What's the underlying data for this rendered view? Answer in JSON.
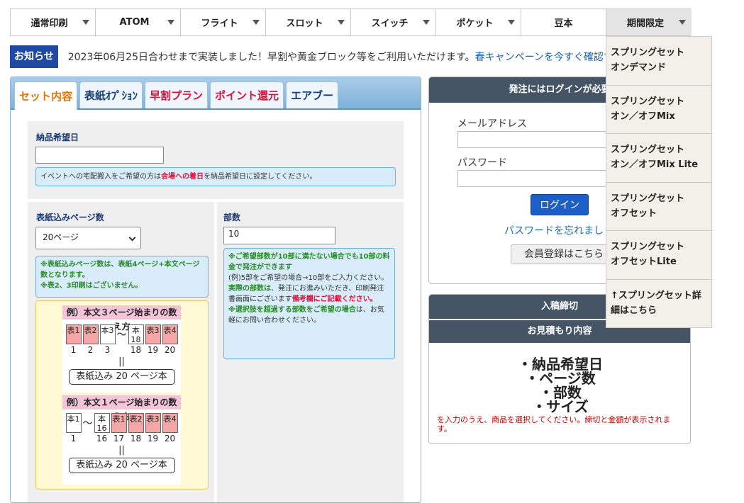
{
  "nav": [
    {
      "label": "通常印刷",
      "arrow": true
    },
    {
      "label": "ATOM",
      "arrow": true
    },
    {
      "label": "フライト",
      "arrow": true
    },
    {
      "label": "スロット",
      "arrow": true
    },
    {
      "label": "スイッチ",
      "arrow": true
    },
    {
      "label": "ポケット",
      "arrow": true
    },
    {
      "label": "豆本",
      "arrow": false
    },
    {
      "label": "期間限定",
      "arrow": true,
      "active": true
    }
  ],
  "notice": {
    "badge": "お知らせ",
    "text": "2023年06月25日合わせまで実装しました！早割や黄金ブロック等をご利用いただけます。",
    "link": "春キャンペーンを今すぐ確認す"
  },
  "tabs": [
    "セット内容",
    "表紙ｵﾌﾟｼｮﾝ",
    "早割プラン",
    "ポイント還元",
    "エアブー"
  ],
  "delivery": {
    "label": "納品希望日",
    "info_pre": "イベントへの宅配搬入をご希望の方は",
    "info_hl": "会場への着日",
    "info_post": "を納品希望日に設定してください。"
  },
  "pages": {
    "label": "表紙込みページ数",
    "selected": "20ページ",
    "info1": "※表紙込みページ数は、表紙4ページ+本文ページ数となります。",
    "info2": "※表2、3印刷はございません。"
  },
  "copies": {
    "label": "部数",
    "value": "10",
    "info1": "※ご希望部数が10部に満たない場合でも10部の料金で発注ができます",
    "info2": "(例)5部をご希望の場合→10部をご入力ください。",
    "info3a": "実際の部数は",
    "info3b": "、発注にお進みいただき、印刷発注書画面にございます",
    "info3c": "備考欄にご記載ください。",
    "info4a": "※選択肢を超過する部数をご希望の場合",
    "info4b": "は、お気軽にお問い合わせください。"
  },
  "diagram": {
    "ex1_title": "例）本文３ページ始まりの数え方",
    "ex1_pages": [
      "表1",
      "表2",
      "本3",
      "本18",
      "表3",
      "表4"
    ],
    "ex1_nums": [
      "1",
      "2",
      "3",
      "18",
      "19",
      "20"
    ],
    "ex1_box": "表紙込み 20 ページ本",
    "ex2_title": "例）本文１ページ始まりの数え方",
    "ex2_pages": [
      "本1",
      "本16",
      "表1",
      "表2",
      "表3",
      "表4"
    ],
    "ex2_nums": [
      "1",
      "16",
      "17",
      "18",
      "19",
      "20"
    ],
    "ex2_box": "表紙込み 20 ページ本",
    "tilde": "〜",
    "eq": "||"
  },
  "login": {
    "header": "発注にはログインが必要",
    "email_label": "メールアドレス",
    "password_label": "パスワード",
    "button": "ログイン",
    "forgot": "パスワードを忘れまし",
    "register": "会員登録はこちら"
  },
  "deadline": {
    "header1": "入稿締切",
    "header2": "お見積もり内容",
    "items": [
      "・納品希望日",
      "・ページ数",
      "・部数",
      "・サイズ"
    ],
    "note": "を入力のうえ、商品を選択してください。締切と金額が表示されます。"
  },
  "dropdown": [
    "スプリングセット\nオンデマンド",
    "スプリングセット\nオン／オフMix",
    "スプリングセット\nオン／オフMix Lite",
    "スプリングセット\nオフセット",
    "スプリングセット\nオフセットLite",
    "↑スプリングセット詳細はこちら"
  ],
  "colors": {
    "badge": "#1f4aa3",
    "accent": "#e0103a",
    "link": "#1a5fb0",
    "header": "#455566"
  }
}
